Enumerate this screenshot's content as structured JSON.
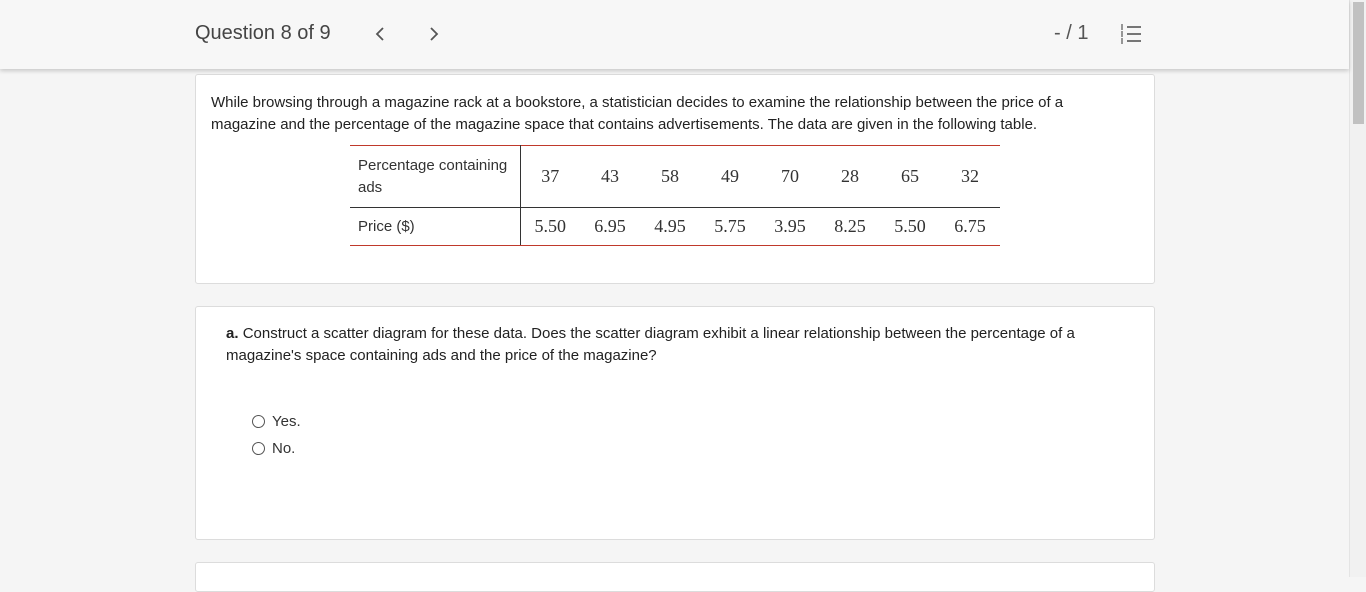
{
  "header": {
    "question_label": "Question 8 of 9",
    "prev_icon": "chevron-left-icon",
    "next_icon": "chevron-right-icon",
    "score": "- / 1",
    "list_icon": "numbered-list-icon"
  },
  "problem": {
    "intro": "While browsing through a magazine rack at a bookstore, a statistician decides to examine the relationship between the price of a magazine and the percentage of the magazine space that contains advertisements. The data are given in the following table.",
    "table": {
      "row1_label": "Percentage containing ads",
      "row1_values": [
        "37",
        "43",
        "58",
        "49",
        "70",
        "28",
        "65",
        "32"
      ],
      "row2_label": "Price ($)",
      "row2_values": [
        "5.50",
        "6.95",
        "4.95",
        "5.75",
        "3.95",
        "8.25",
        "5.50",
        "6.75"
      ]
    }
  },
  "part_a": {
    "prefix": "a.",
    "text": "Construct a scatter diagram for these data. Does the scatter diagram exhibit a linear relationship between the percentage of a magazine's space containing ads and the price of the magazine?",
    "options": [
      "Yes.",
      "No."
    ]
  }
}
